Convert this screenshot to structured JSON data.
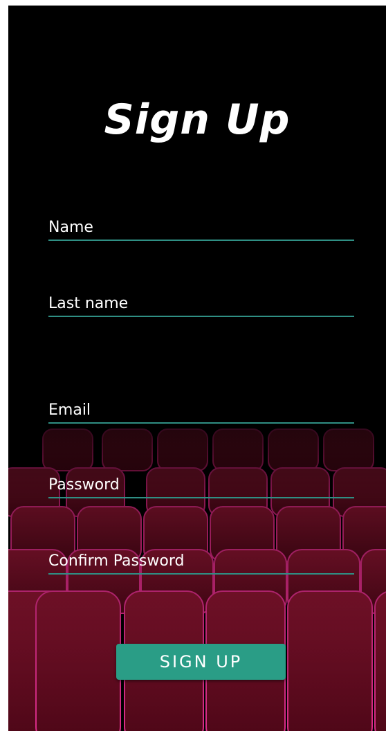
{
  "title": "Sign Up",
  "fields": [
    {
      "label": "Name"
    },
    {
      "label": "Last name"
    },
    {
      "label": "Email"
    },
    {
      "label": "Password"
    },
    {
      "label": "Confirm Password"
    }
  ],
  "submit_label": "SIGN UP",
  "colors": {
    "background": "#000000",
    "accent": "#2a9d86",
    "underline": "#2f8f84",
    "seat": "#7a0d25",
    "seat_edge": "#d0237a"
  }
}
